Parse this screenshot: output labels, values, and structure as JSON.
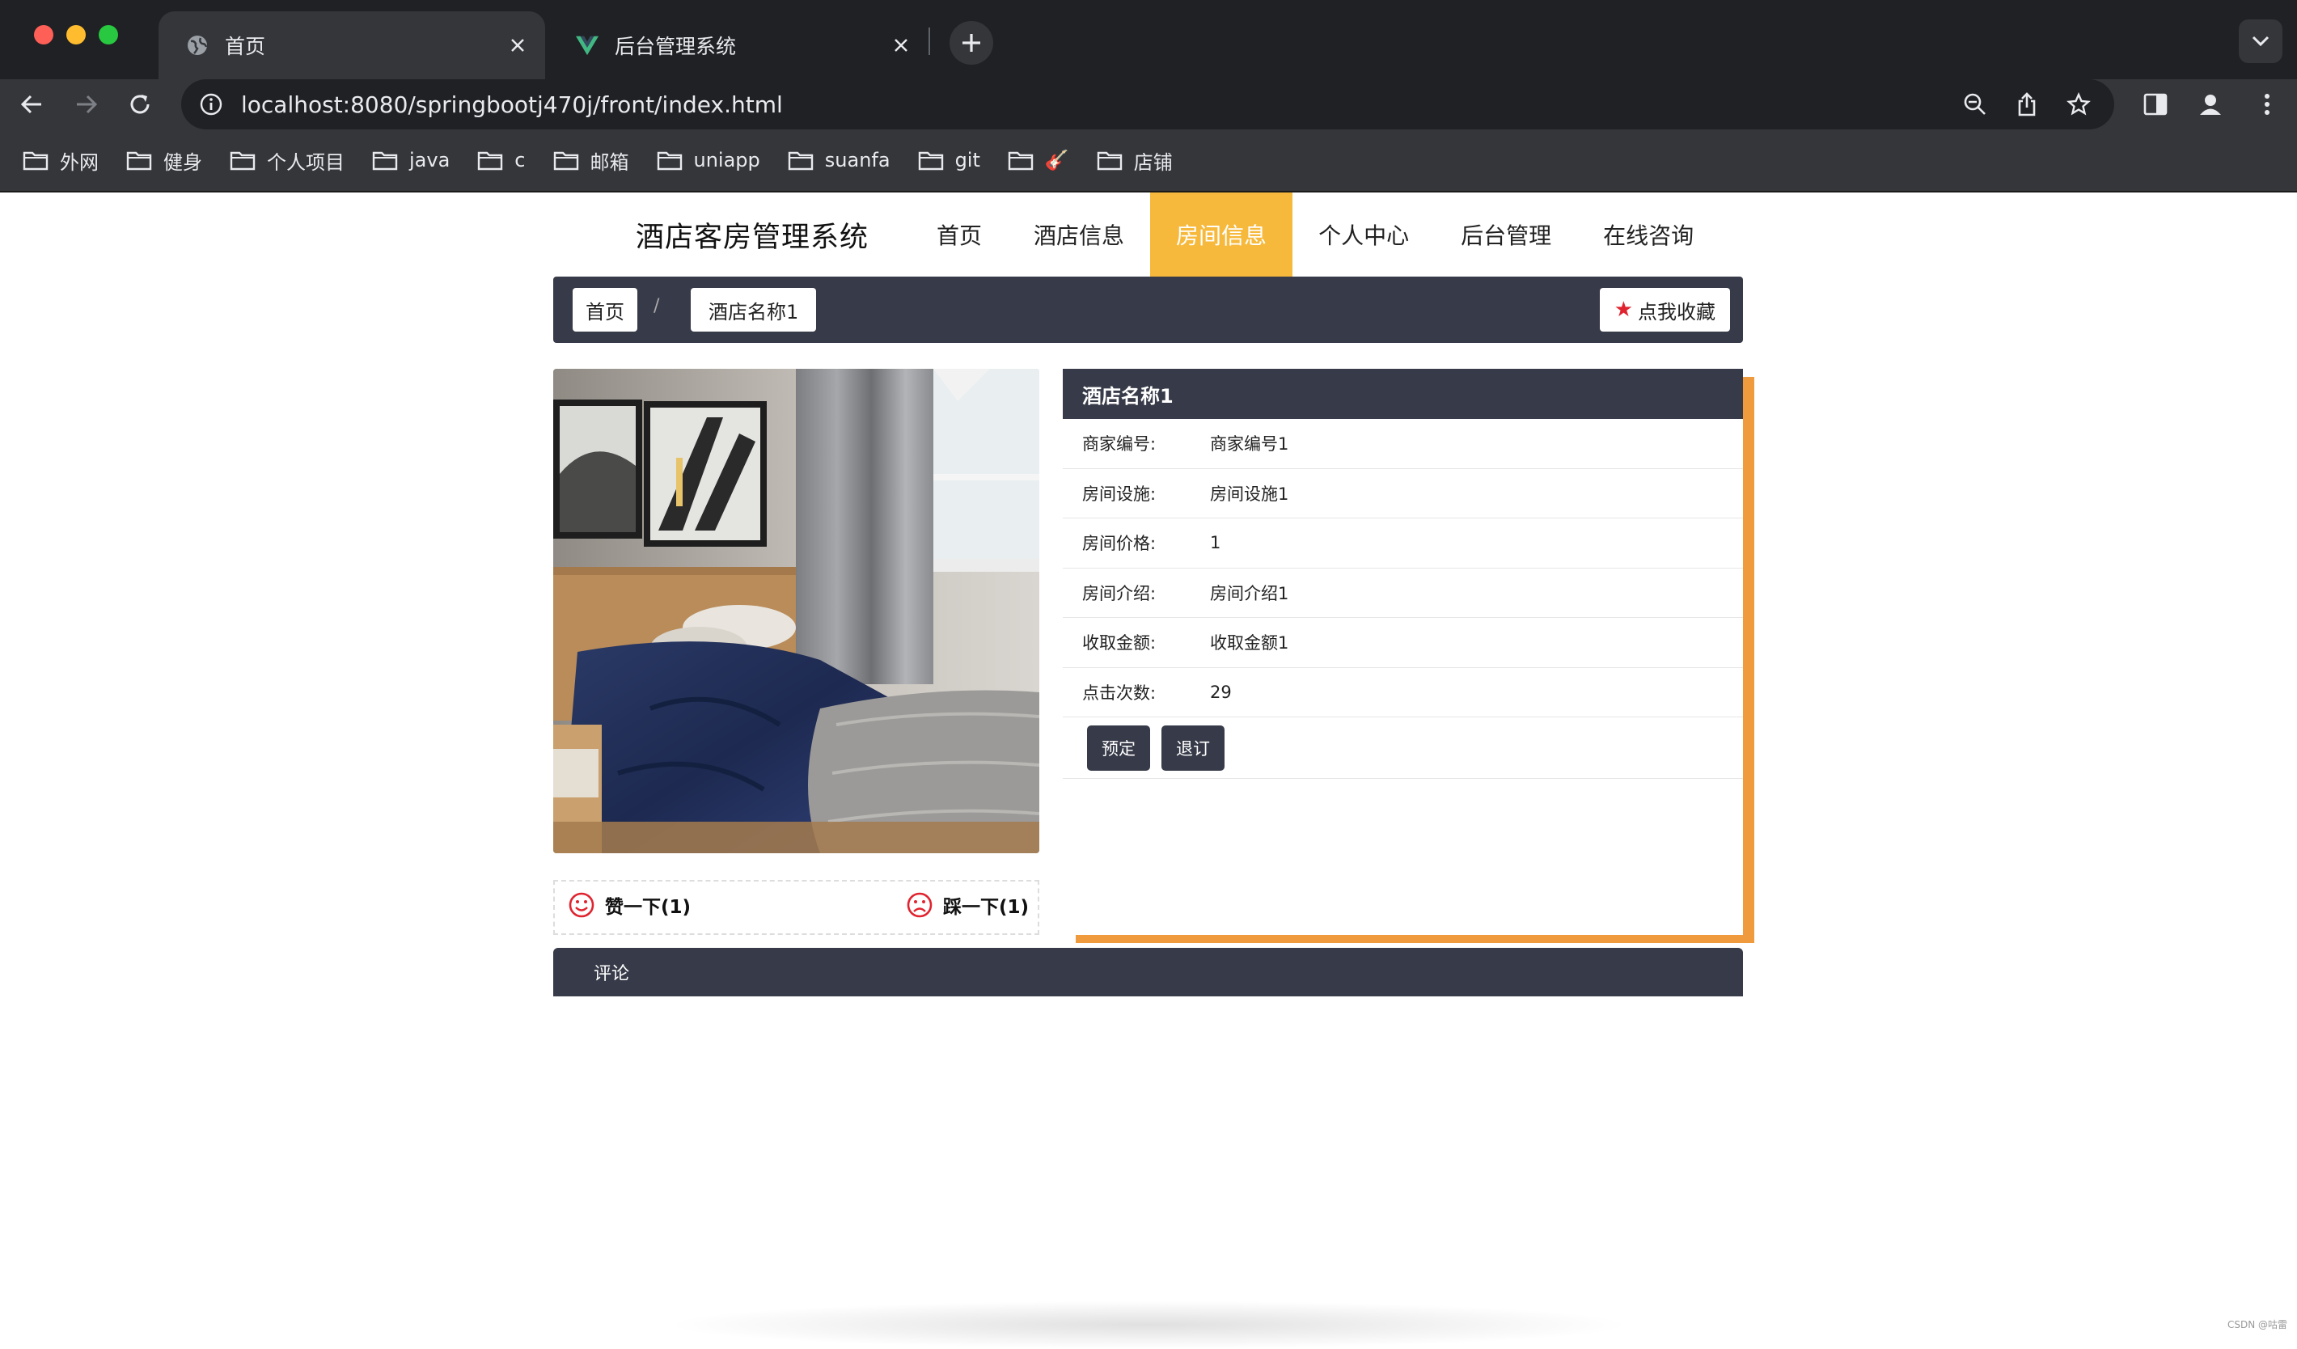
{
  "browser": {
    "tabs": [
      {
        "title": "首页",
        "active": true
      },
      {
        "title": "后台管理系统",
        "active": false
      }
    ],
    "url": "localhost:8080/springbootj470j/front/index.html",
    "bookmarks": [
      "外网",
      "健身",
      "个人项目",
      "java",
      "c",
      "邮箱",
      "uniapp",
      "suanfa",
      "git",
      "🎸",
      "店铺"
    ]
  },
  "site": {
    "brand": "酒店客房管理系统",
    "nav": [
      "首页",
      "酒店信息",
      "房间信息",
      "个人中心",
      "后台管理",
      "在线咨询"
    ],
    "active_nav": "房间信息"
  },
  "breadcrumb": {
    "home": "首页",
    "separator": "/",
    "current": "酒店名称1",
    "favorite": "点我收藏"
  },
  "detail": {
    "title": "酒店名称1",
    "rows": [
      {
        "label": "商家编号:",
        "value": "商家编号1"
      },
      {
        "label": "房间设施:",
        "value": "房间设施1"
      },
      {
        "label": "房间价格:",
        "value": "1"
      },
      {
        "label": "房间介绍:",
        "value": "房间介绍1"
      },
      {
        "label": "收取金额:",
        "value": "收取金额1"
      },
      {
        "label": "点击次数:",
        "value": "29"
      }
    ],
    "book": "预定",
    "cancel": "退订"
  },
  "vote": {
    "like": "赞一下(1)",
    "dislike": "踩一下(1)"
  },
  "comments": {
    "title": "评论"
  },
  "watermark": "CSDN @咕雷",
  "colors": {
    "accent_nav": "#f6b93b",
    "accent_border": "#f09a3e",
    "dark_panel": "#373a48",
    "star": "#e0242f"
  }
}
